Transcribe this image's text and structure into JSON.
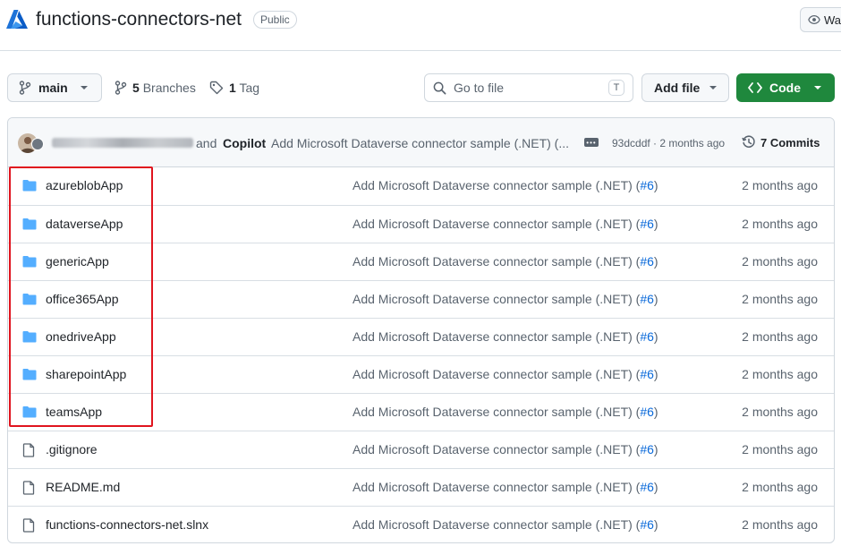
{
  "repo": {
    "name": "functions-connectors-net",
    "visibility": "Public",
    "watch_label": "Watch"
  },
  "toolbar": {
    "branch": "main",
    "branches_count": "5",
    "branches_label": "Branches",
    "tags_count": "1",
    "tags_label": "Tag",
    "search_placeholder": "Go to file",
    "search_shortcut": "T",
    "add_file_label": "Add file",
    "code_label": "Code"
  },
  "commit": {
    "and": "and",
    "coauthor": "Copilot",
    "message": "Add Microsoft Dataverse connector sample (.NET) (...",
    "hash_time": "93dcddf · 2 months ago",
    "commits_label": "7 Commits"
  },
  "files": [
    {
      "type": "folder",
      "name": "azureblobApp",
      "message": "Add Microsoft Dataverse connector sample (.NET) (",
      "pr": "#6",
      "message_end": ")",
      "date": "2 months ago"
    },
    {
      "type": "folder",
      "name": "dataverseApp",
      "message": "Add Microsoft Dataverse connector sample (.NET) (",
      "pr": "#6",
      "message_end": ")",
      "date": "2 months ago"
    },
    {
      "type": "folder",
      "name": "genericApp",
      "message": "Add Microsoft Dataverse connector sample (.NET) (",
      "pr": "#6",
      "message_end": ")",
      "date": "2 months ago"
    },
    {
      "type": "folder",
      "name": "office365App",
      "message": "Add Microsoft Dataverse connector sample (.NET) (",
      "pr": "#6",
      "message_end": ")",
      "date": "2 months ago"
    },
    {
      "type": "folder",
      "name": "onedriveApp",
      "message": "Add Microsoft Dataverse connector sample (.NET) (",
      "pr": "#6",
      "message_end": ")",
      "date": "2 months ago"
    },
    {
      "type": "folder",
      "name": "sharepointApp",
      "message": "Add Microsoft Dataverse connector sample (.NET) (",
      "pr": "#6",
      "message_end": ")",
      "date": "2 months ago"
    },
    {
      "type": "folder",
      "name": "teamsApp",
      "message": "Add Microsoft Dataverse connector sample (.NET) (",
      "pr": "#6",
      "message_end": ")",
      "date": "2 months ago"
    },
    {
      "type": "file",
      "name": ".gitignore",
      "message": "Add Microsoft Dataverse connector sample (.NET) (",
      "pr": "#6",
      "message_end": ")",
      "date": "2 months ago"
    },
    {
      "type": "file",
      "name": "README.md",
      "message": "Add Microsoft Dataverse connector sample (.NET) (",
      "pr": "#6",
      "message_end": ")",
      "date": "2 months ago"
    },
    {
      "type": "file",
      "name": "functions-connectors-net.slnx",
      "message": "Add Microsoft Dataverse connector sample (.NET) (",
      "pr": "#6",
      "message_end": ")",
      "date": "2 months ago"
    }
  ],
  "colors": {
    "folder": "#54aeff",
    "accent_link": "#0969da",
    "code_button": "#1f883d",
    "highlight": "#e0141e"
  },
  "icons": {
    "logo": "azure-logo-icon",
    "folder": "folder-icon",
    "file": "file-icon"
  }
}
